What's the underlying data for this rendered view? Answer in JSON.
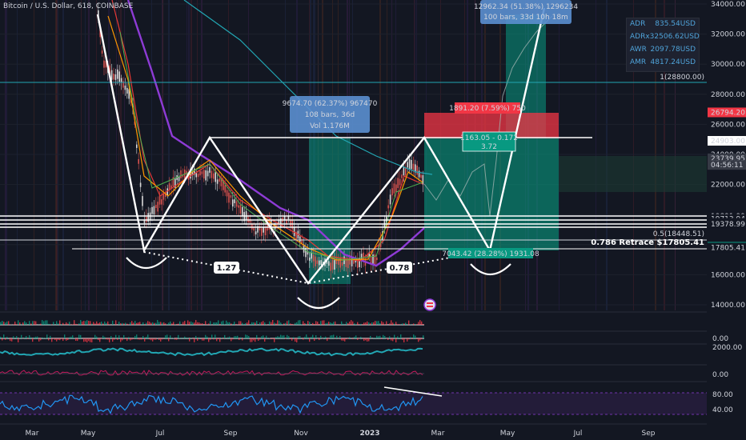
{
  "header": {
    "title": "Bitcoin / U.S. Dollar, 618, COINBASE"
  },
  "stats_panel": [
    {
      "label": "ADR",
      "value": "835.54USD"
    },
    {
      "label": "ADRx3",
      "value": "2506.62USD"
    },
    {
      "label": "AWR",
      "value": "2097.78USD"
    },
    {
      "label": "AMR",
      "value": "4817.24USD"
    }
  ],
  "chart_data": {
    "type": "line",
    "title": "Bitcoin / U.S. Dollar, 618, COINBASE",
    "ylim": [
      13000,
      35000
    ],
    "y_ticks": [
      "34000.00",
      "32000.00",
      "30000.00",
      "28000.00",
      "26000.00",
      "24000.00",
      "22000.00",
      "20000.00",
      "18000.00",
      "16000.00",
      "14000.00"
    ],
    "x_ticks": [
      "Mar",
      "May",
      "Jul",
      "Sep",
      "Nov",
      "2023",
      "Mar",
      "May",
      "Jul",
      "Sep"
    ],
    "price_labels": [
      {
        "text": "26794.20",
        "value": 26794.2,
        "color": "#f23645"
      },
      {
        "text": "24903.00",
        "value": 24903,
        "color": "#ffffff"
      },
      {
        "text": "23739.95",
        "value": 23739.95,
        "color": "#363a45"
      },
      {
        "text": "04:56:11",
        "value": 23300,
        "color": "#363a45"
      },
      {
        "text": "19891.99",
        "value": 19892,
        "color": "#131722"
      },
      {
        "text": "19713.94",
        "value": 19714,
        "color": "#131722"
      },
      {
        "text": "19448.64",
        "value": 19449,
        "color": "#131722"
      },
      {
        "text": "19378.99",
        "value": 19379,
        "color": "#131722"
      },
      {
        "text": "17859.58",
        "value": 17860,
        "color": "#089981"
      },
      {
        "text": "17805.41",
        "value": 17805,
        "color": "#131722"
      }
    ],
    "horizontal_levels": [
      {
        "label": "1(28800.00)",
        "value": 28800,
        "color": "#22a6b3"
      },
      {
        "label": "0.5(18448.51)",
        "value": 18448.51,
        "color": "#d1d4dc"
      },
      {
        "label": "0.786 Retrace $17805.41",
        "value": 17805.41,
        "color": "#ffffff"
      }
    ],
    "pattern_labels": [
      "1.27",
      "0.78"
    ],
    "measure_boxes": [
      {
        "line1": "9674.70 (62.37%) 967470",
        "line2": "108 bars, 36d",
        "line3": "Vol 1.176M"
      },
      {
        "line1": "12962.34 (51.38%) 1296234",
        "line2": "100 bars, 33d 10h 18m"
      }
    ],
    "position_labels": [
      {
        "text": "1891.20 (7.59%) 750",
        "color": "#f23645"
      },
      {
        "text": "1163.05 - 0.172",
        "sub": "3.72",
        "color": "#089981"
      },
      {
        "text": "7043.42 (28.28%) 1931.08",
        "color": "#089981"
      }
    ],
    "indicator_ticks": [
      "0.00",
      "2000.00",
      "0.00",
      "80.00",
      "40.00"
    ],
    "price_series": {
      "x": [
        "2022-03",
        "2022-04",
        "2022-05",
        "2022-06",
        "2022-07",
        "2022-08",
        "2022-09",
        "2022-10",
        "2022-11",
        "2022-12",
        "2023-01",
        "2023-02"
      ],
      "close": [
        47000,
        40000,
        31000,
        19500,
        23000,
        24500,
        19500,
        20500,
        16000,
        16800,
        23000,
        23740
      ]
    }
  }
}
